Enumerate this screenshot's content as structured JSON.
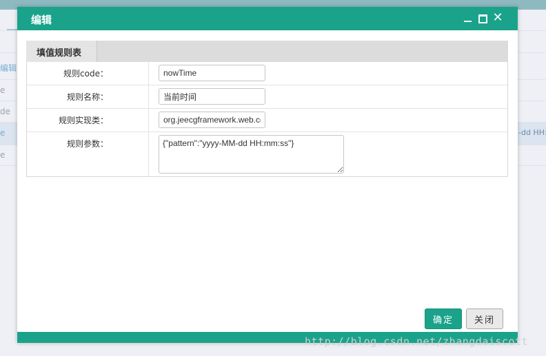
{
  "background": {
    "left_texts": [
      "编辑",
      "e",
      "de",
      "e",
      "e"
    ],
    "right_text": "-dd HH:"
  },
  "dialog": {
    "title": "编辑",
    "panel_tab": "填值规则表",
    "fields": {
      "code": {
        "label": "规则code：",
        "value": "nowTime"
      },
      "name": {
        "label": "规则名称：",
        "value": "当前时间"
      },
      "class": {
        "label": "规则实现类：",
        "value": "org.jeecgframework.web.cgform.service.impl.NowTimeRule"
      },
      "params": {
        "label": "规则参数：",
        "value": "{\"pattern\":\"yyyy-MM-dd HH:mm:ss\"}"
      }
    },
    "buttons": {
      "ok": "确定",
      "close": "关闭"
    },
    "close_glyph": "✕"
  },
  "watermark": "http://blog.csdn.net/zhangdaiscott",
  "colors": {
    "accent": "#1aa38a"
  }
}
